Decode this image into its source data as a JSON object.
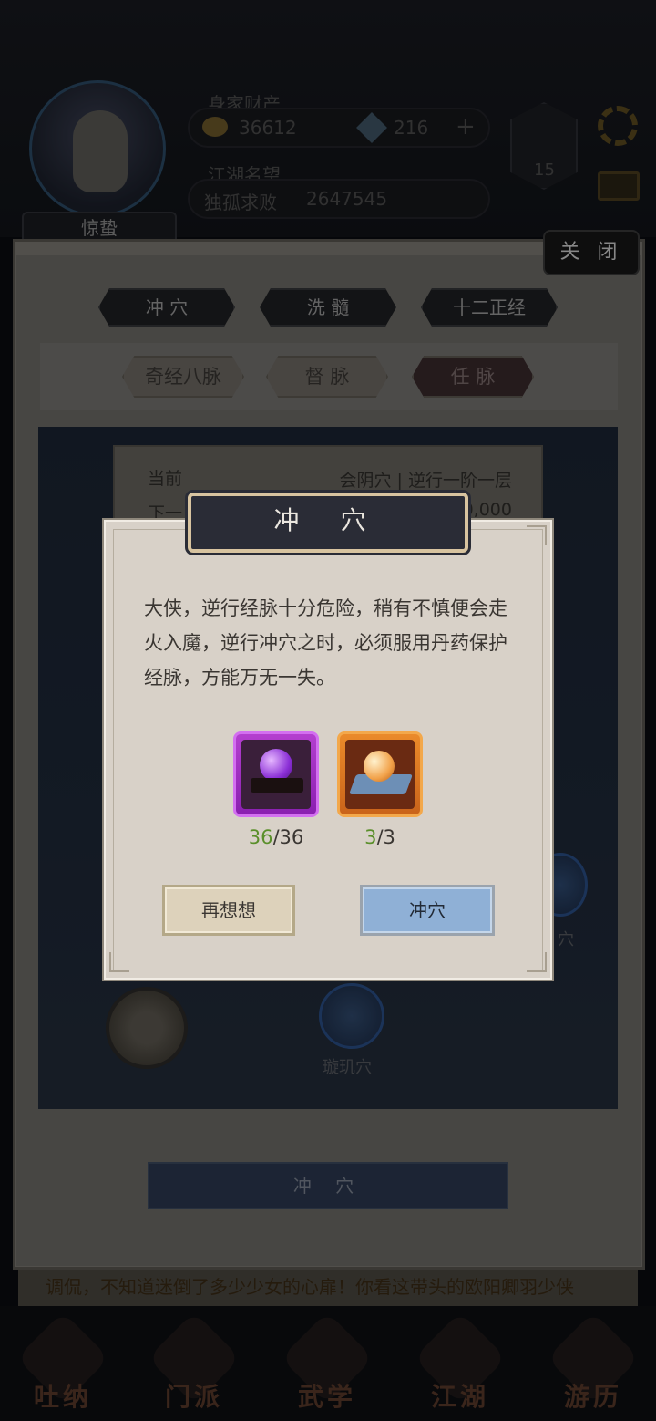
{
  "header": {
    "player_name": "惊蛰",
    "wealth_label": "身家财产",
    "coins": "36612",
    "gems": "216",
    "plus": "+",
    "fame_label": "江湖名望",
    "fame_title": "独孤求败",
    "fame_value": "2647545",
    "level": "15"
  },
  "panel": {
    "close_label": "关 闭",
    "tabs": [
      "冲 穴",
      "洗 髓",
      "十二正经"
    ],
    "subtabs": [
      "奇经八脉",
      "督 脉",
      "任 脉"
    ],
    "info": {
      "current_label": "当前",
      "current_value": "会阴穴 | 逆行一阶一层",
      "next_label": "下一",
      "next_value": "0,000"
    },
    "nodes": {
      "bottom_label": "璇玑穴",
      "right_label": "穴"
    },
    "action_button": "冲 穴"
  },
  "ticker": "调侃，不知道迷倒了多少少女的心扉！你看这带头的欧阳卿羽少侠",
  "bottom_nav": [
    "吐纳",
    "门派",
    "武学",
    "江湖",
    "游历"
  ],
  "dialog": {
    "title": "冲 穴",
    "message": "大侠，逆行经脉十分危险，稍有不慎便会走火入魔，逆行冲穴之时，必须服用丹药保护经脉，方能万无一失。",
    "items": [
      {
        "icon": "purple-orb-icon",
        "have": "36",
        "need": "/36"
      },
      {
        "icon": "orange-orb-icon",
        "have": "3",
        "need": "/3"
      }
    ],
    "cancel_label": "再想想",
    "confirm_label": "冲穴",
    "colors": {
      "have": "#5a8f2a",
      "confirm": "#8fb0d6",
      "title_bg": "#2a2c36"
    }
  }
}
